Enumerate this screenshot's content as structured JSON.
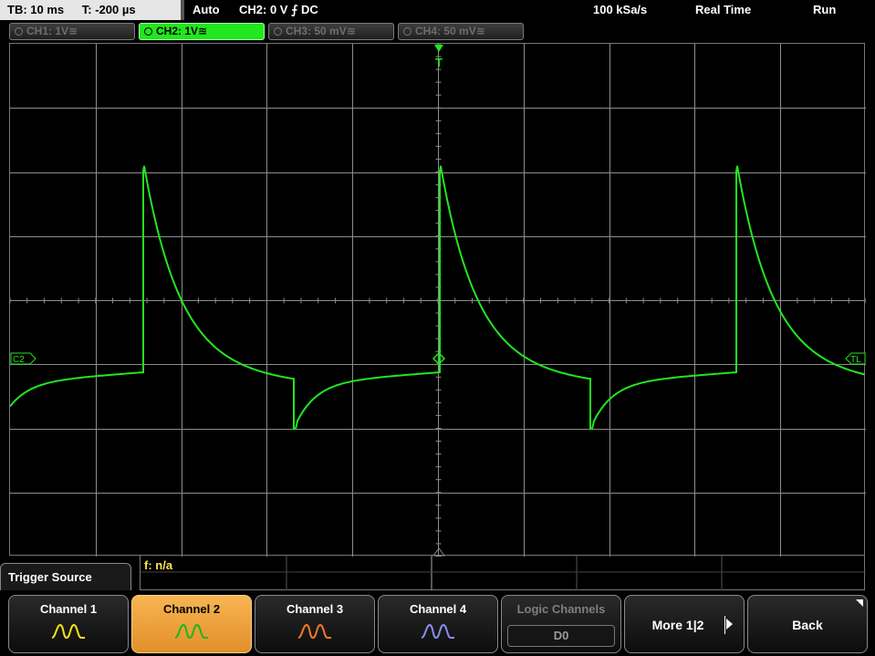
{
  "status_bar": {
    "timebase": "TB: 10 ms",
    "trigger_time": "T: -200 µs",
    "trigger_mode": "Auto",
    "trigger_condition": "CH2: 0 V ⨍ DC",
    "sample_rate": "100 kSa/s",
    "acquisition": "Real Time",
    "run_state": "Run"
  },
  "channel_tabs": [
    {
      "label": "CH1: 1V≊",
      "active": false
    },
    {
      "label": "CH2: 1V≊",
      "active": true
    },
    {
      "label": "CH3: 50 mV≊",
      "active": false
    },
    {
      "label": "CH4: 50 mV≊",
      "active": false
    }
  ],
  "waveform": {
    "channel": "CH2",
    "color": "#22e61e",
    "marker_left": "C2",
    "marker_right": "TL",
    "trigger_marker": "T"
  },
  "measurement": {
    "frequency": "f: n/a"
  },
  "menu": {
    "title": "Trigger Source",
    "keys": [
      {
        "label": "Channel 1",
        "wave_color": "#f2e01d",
        "state": "normal"
      },
      {
        "label": "Channel 2",
        "wave_color": "#1fb51c",
        "state": "selected"
      },
      {
        "label": "Channel 3",
        "wave_color": "#f07a28",
        "state": "normal"
      },
      {
        "label": "Channel 4",
        "wave_color": "#8a8cf0",
        "state": "normal"
      },
      {
        "label": "Logic Channels",
        "sub_label": "D0",
        "state": "disabled"
      },
      {
        "label": "More 1|2",
        "state": "normal"
      },
      {
        "label": "Back",
        "state": "normal"
      }
    ]
  },
  "colors": {
    "grid": "#8c8c8c",
    "trace": "#22e61e",
    "selected_key": "#f0a33e"
  }
}
